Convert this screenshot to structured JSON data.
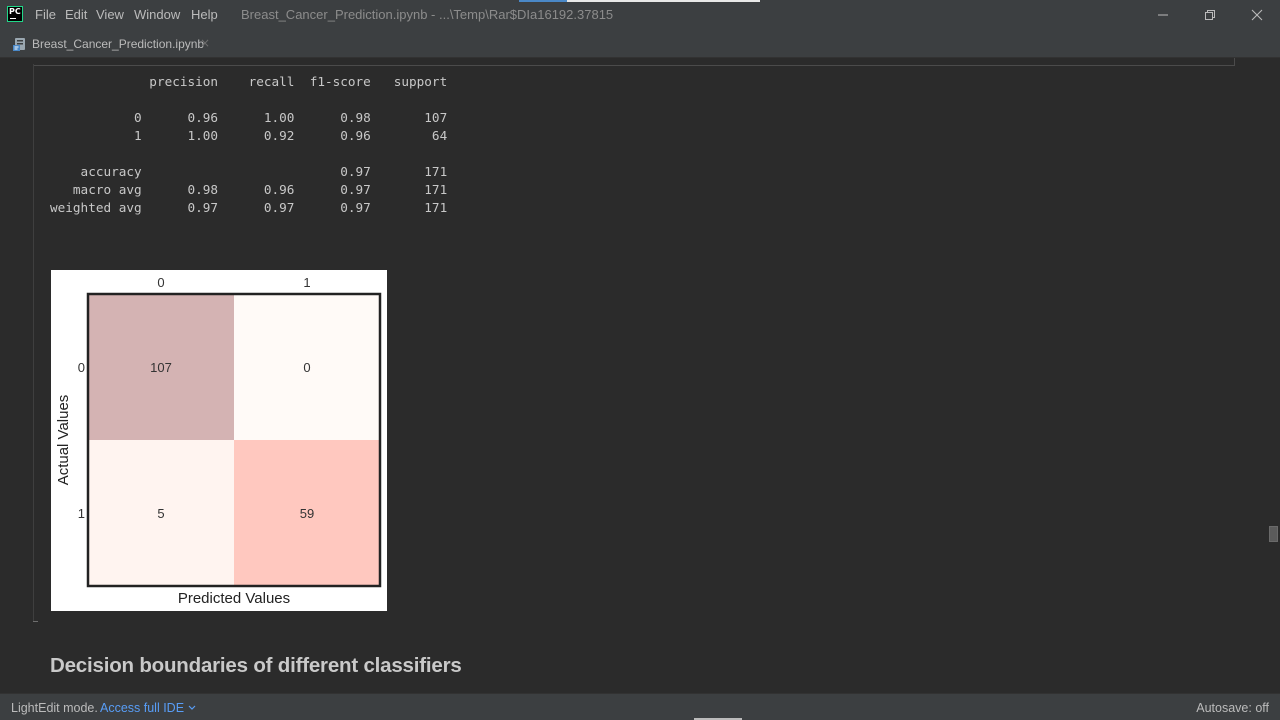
{
  "app": {
    "title": "Breast_Cancer_Prediction.ipynb - ...\\Temp\\Rar$DIa16192.37815",
    "logo_text": "PC"
  },
  "menu": {
    "file": "File",
    "edit": "Edit",
    "view": "View",
    "window": "Window",
    "help": "Help"
  },
  "tab": {
    "label": "Breast_Cancer_Prediction.ipynb",
    "close": "×"
  },
  "report": {
    "header": [
      "precision",
      "recall",
      "f1-score",
      "support"
    ],
    "rows": [
      {
        "label": "0",
        "values": [
          "0.96",
          "1.00",
          "0.98",
          "107"
        ]
      },
      {
        "label": "1",
        "values": [
          "1.00",
          "0.92",
          "0.96",
          "64"
        ]
      },
      null,
      {
        "label": "accuracy",
        "values": [
          "",
          "",
          "0.97",
          "171"
        ]
      },
      {
        "label": "macro avg",
        "values": [
          "0.98",
          "0.96",
          "0.97",
          "171"
        ]
      },
      {
        "label": "weighted avg",
        "values": [
          "0.97",
          "0.97",
          "0.97",
          "171"
        ]
      }
    ]
  },
  "chart_data": {
    "type": "heatmap",
    "x_categories": [
      "0",
      "1"
    ],
    "y_categories": [
      "0",
      "1"
    ],
    "values": [
      [
        107,
        0
      ],
      [
        5,
        59
      ]
    ],
    "xlabel": "Predicted Values",
    "ylabel": "Actual Values",
    "x_ticks_position": "top",
    "colors": [
      [
        "#d4b3b3",
        "#fffaf7"
      ],
      [
        "#fff4f0",
        "#ffc8bf"
      ]
    ]
  },
  "section": {
    "heading": "Decision boundaries of different classifiers"
  },
  "status": {
    "mode": "LightEdit mode.",
    "link": "Access full IDE",
    "autosave": "Autosave: off"
  },
  "colors": {
    "accent": "#589df6",
    "editor_bg": "#2b2b2b",
    "chrome_bg": "#3c3f41"
  }
}
